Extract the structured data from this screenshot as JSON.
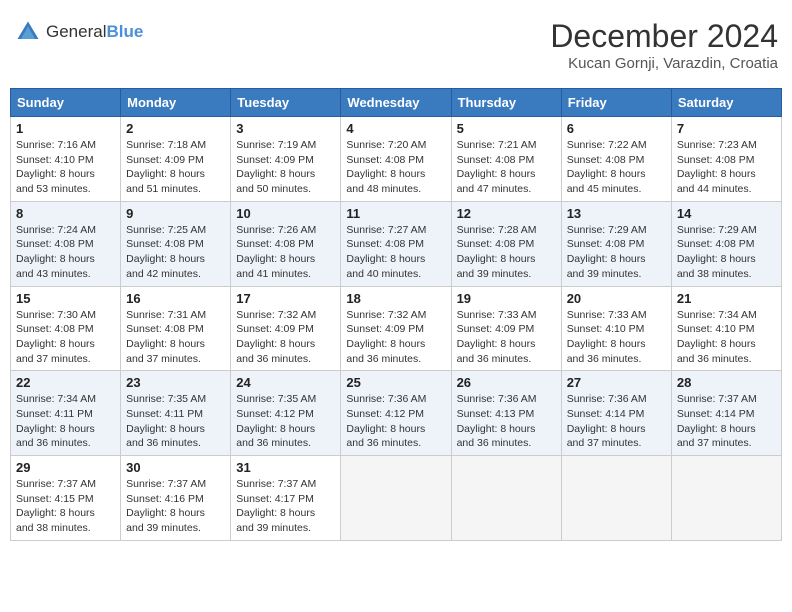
{
  "header": {
    "logo_general": "General",
    "logo_blue": "Blue",
    "title": "December 2024",
    "location": "Kucan Gornji, Varazdin, Croatia"
  },
  "calendar": {
    "days_of_week": [
      "Sunday",
      "Monday",
      "Tuesday",
      "Wednesday",
      "Thursday",
      "Friday",
      "Saturday"
    ],
    "weeks": [
      [
        {
          "day": "",
          "info": ""
        },
        {
          "day": "2",
          "sunrise": "Sunrise: 7:18 AM",
          "sunset": "Sunset: 4:09 PM",
          "daylight": "Daylight: 8 hours and 51 minutes."
        },
        {
          "day": "3",
          "sunrise": "Sunrise: 7:19 AM",
          "sunset": "Sunset: 4:09 PM",
          "daylight": "Daylight: 8 hours and 50 minutes."
        },
        {
          "day": "4",
          "sunrise": "Sunrise: 7:20 AM",
          "sunset": "Sunset: 4:08 PM",
          "daylight": "Daylight: 8 hours and 48 minutes."
        },
        {
          "day": "5",
          "sunrise": "Sunrise: 7:21 AM",
          "sunset": "Sunset: 4:08 PM",
          "daylight": "Daylight: 8 hours and 47 minutes."
        },
        {
          "day": "6",
          "sunrise": "Sunrise: 7:22 AM",
          "sunset": "Sunset: 4:08 PM",
          "daylight": "Daylight: 8 hours and 45 minutes."
        },
        {
          "day": "7",
          "sunrise": "Sunrise: 7:23 AM",
          "sunset": "Sunset: 4:08 PM",
          "daylight": "Daylight: 8 hours and 44 minutes."
        }
      ],
      [
        {
          "day": "1",
          "sunrise": "Sunrise: 7:16 AM",
          "sunset": "Sunset: 4:10 PM",
          "daylight": "Daylight: 8 hours and 53 minutes."
        },
        {
          "day": "9",
          "sunrise": "Sunrise: 7:25 AM",
          "sunset": "Sunset: 4:08 PM",
          "daylight": "Daylight: 8 hours and 42 minutes."
        },
        {
          "day": "10",
          "sunrise": "Sunrise: 7:26 AM",
          "sunset": "Sunset: 4:08 PM",
          "daylight": "Daylight: 8 hours and 41 minutes."
        },
        {
          "day": "11",
          "sunrise": "Sunrise: 7:27 AM",
          "sunset": "Sunset: 4:08 PM",
          "daylight": "Daylight: 8 hours and 40 minutes."
        },
        {
          "day": "12",
          "sunrise": "Sunrise: 7:28 AM",
          "sunset": "Sunset: 4:08 PM",
          "daylight": "Daylight: 8 hours and 39 minutes."
        },
        {
          "day": "13",
          "sunrise": "Sunrise: 7:29 AM",
          "sunset": "Sunset: 4:08 PM",
          "daylight": "Daylight: 8 hours and 39 minutes."
        },
        {
          "day": "14",
          "sunrise": "Sunrise: 7:29 AM",
          "sunset": "Sunset: 4:08 PM",
          "daylight": "Daylight: 8 hours and 38 minutes."
        }
      ],
      [
        {
          "day": "8",
          "sunrise": "Sunrise: 7:24 AM",
          "sunset": "Sunset: 4:08 PM",
          "daylight": "Daylight: 8 hours and 43 minutes."
        },
        {
          "day": "16",
          "sunrise": "Sunrise: 7:31 AM",
          "sunset": "Sunset: 4:08 PM",
          "daylight": "Daylight: 8 hours and 37 minutes."
        },
        {
          "day": "17",
          "sunrise": "Sunrise: 7:32 AM",
          "sunset": "Sunset: 4:09 PM",
          "daylight": "Daylight: 8 hours and 36 minutes."
        },
        {
          "day": "18",
          "sunrise": "Sunrise: 7:32 AM",
          "sunset": "Sunset: 4:09 PM",
          "daylight": "Daylight: 8 hours and 36 minutes."
        },
        {
          "day": "19",
          "sunrise": "Sunrise: 7:33 AM",
          "sunset": "Sunset: 4:09 PM",
          "daylight": "Daylight: 8 hours and 36 minutes."
        },
        {
          "day": "20",
          "sunrise": "Sunrise: 7:33 AM",
          "sunset": "Sunset: 4:10 PM",
          "daylight": "Daylight: 8 hours and 36 minutes."
        },
        {
          "day": "21",
          "sunrise": "Sunrise: 7:34 AM",
          "sunset": "Sunset: 4:10 PM",
          "daylight": "Daylight: 8 hours and 36 minutes."
        }
      ],
      [
        {
          "day": "15",
          "sunrise": "Sunrise: 7:30 AM",
          "sunset": "Sunset: 4:08 PM",
          "daylight": "Daylight: 8 hours and 37 minutes."
        },
        {
          "day": "23",
          "sunrise": "Sunrise: 7:35 AM",
          "sunset": "Sunset: 4:11 PM",
          "daylight": "Daylight: 8 hours and 36 minutes."
        },
        {
          "day": "24",
          "sunrise": "Sunrise: 7:35 AM",
          "sunset": "Sunset: 4:12 PM",
          "daylight": "Daylight: 8 hours and 36 minutes."
        },
        {
          "day": "25",
          "sunrise": "Sunrise: 7:36 AM",
          "sunset": "Sunset: 4:12 PM",
          "daylight": "Daylight: 8 hours and 36 minutes."
        },
        {
          "day": "26",
          "sunrise": "Sunrise: 7:36 AM",
          "sunset": "Sunset: 4:13 PM",
          "daylight": "Daylight: 8 hours and 36 minutes."
        },
        {
          "day": "27",
          "sunrise": "Sunrise: 7:36 AM",
          "sunset": "Sunset: 4:14 PM",
          "daylight": "Daylight: 8 hours and 37 minutes."
        },
        {
          "day": "28",
          "sunrise": "Sunrise: 7:37 AM",
          "sunset": "Sunset: 4:14 PM",
          "daylight": "Daylight: 8 hours and 37 minutes."
        }
      ],
      [
        {
          "day": "22",
          "sunrise": "Sunrise: 7:34 AM",
          "sunset": "Sunset: 4:11 PM",
          "daylight": "Daylight: 8 hours and 36 minutes."
        },
        {
          "day": "30",
          "sunrise": "Sunrise: 7:37 AM",
          "sunset": "Sunset: 4:16 PM",
          "daylight": "Daylight: 8 hours and 39 minutes."
        },
        {
          "day": "31",
          "sunrise": "Sunrise: 7:37 AM",
          "sunset": "Sunset: 4:17 PM",
          "daylight": "Daylight: 8 hours and 39 minutes."
        },
        {
          "day": "",
          "info": ""
        },
        {
          "day": "",
          "info": ""
        },
        {
          "day": "",
          "info": ""
        },
        {
          "day": "",
          "info": ""
        }
      ],
      [
        {
          "day": "29",
          "sunrise": "Sunrise: 7:37 AM",
          "sunset": "Sunset: 4:15 PM",
          "daylight": "Daylight: 8 hours and 38 minutes."
        },
        {
          "day": "",
          "info": ""
        },
        {
          "day": "",
          "info": ""
        },
        {
          "day": "",
          "info": ""
        },
        {
          "day": "",
          "info": ""
        },
        {
          "day": "",
          "info": ""
        },
        {
          "day": "",
          "info": ""
        }
      ]
    ]
  }
}
